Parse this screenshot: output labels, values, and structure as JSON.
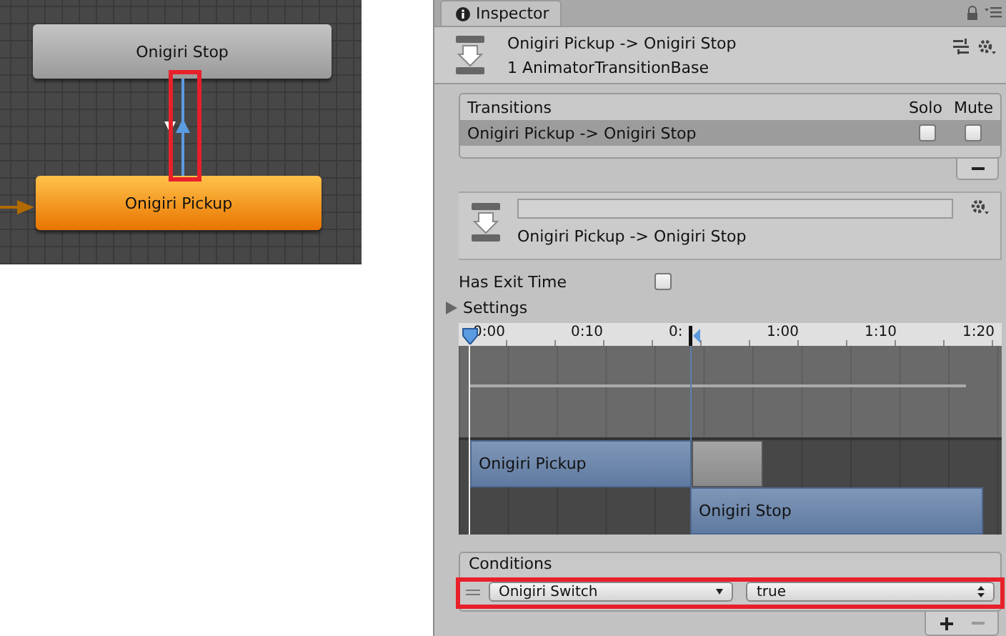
{
  "graph": {
    "states": [
      {
        "name": "Onigiri Stop",
        "kind": "normal"
      },
      {
        "name": "Onigiri Pickup",
        "kind": "default"
      }
    ]
  },
  "inspector": {
    "tab": "Inspector",
    "title": "Onigiri Pickup -> Onigiri Stop",
    "subtitle": "1 AnimatorTransitionBase",
    "transitions": {
      "heading": "Transitions",
      "solo_label": "Solo",
      "mute_label": "Mute",
      "rows": [
        {
          "name": "Onigiri Pickup -> Onigiri Stop",
          "selected": true,
          "solo": false,
          "mute": false
        }
      ]
    },
    "transition": {
      "label": "Onigiri Pickup -> Onigiri Stop"
    },
    "has_exit_time": {
      "label": "Has Exit Time",
      "checked": false
    },
    "settings": {
      "label": "Settings",
      "expanded": false
    },
    "timeline": {
      "ticks": [
        "0:00",
        "0:10",
        "0:",
        "1:00",
        "1:10",
        "1:20"
      ],
      "clips": [
        {
          "name": "Onigiri Pickup"
        },
        {
          "name": "Onigiri Stop"
        }
      ]
    },
    "conditions": {
      "heading": "Conditions",
      "rows": [
        {
          "parameter": "Onigiri Switch",
          "value": "true"
        }
      ]
    }
  }
}
